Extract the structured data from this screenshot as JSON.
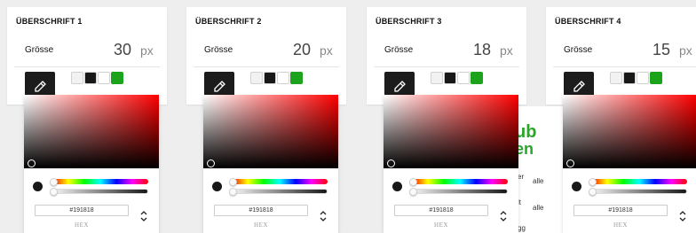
{
  "colors": {
    "swatch_white": "#f2f2f2",
    "swatch_black": "#191818",
    "swatch_light": "#ffffff",
    "swatch_green": "#1ca31c",
    "accent_green": "#2aa52a"
  },
  "panels": [
    {
      "title": "ÜBERSCHRIFT 1",
      "size_label": "Grösse",
      "size_value": "30",
      "unit": "px",
      "hex_value": "#191818",
      "hex_label": "HEX"
    },
    {
      "title": "ÜBERSCHRIFT 2",
      "size_label": "Grösse",
      "size_value": "20",
      "unit": "px",
      "hex_value": "#191818",
      "hex_label": "HEX"
    },
    {
      "title": "ÜBERSCHRIFT 3",
      "size_label": "Grösse",
      "size_value": "18",
      "unit": "px",
      "hex_value": "#191818",
      "hex_label": "HEX"
    },
    {
      "title": "ÜBERSCHRIFT 4",
      "size_label": "Grösse",
      "size_value": "15",
      "unit": "px",
      "hex_value": "#191818",
      "hex_label": "HEX"
    }
  ],
  "background": {
    "word_top": "ub",
    "word_bottom": "en",
    "small_texts": [
      "er",
      "alle",
      "lt",
      "alle",
      "gg"
    ]
  }
}
